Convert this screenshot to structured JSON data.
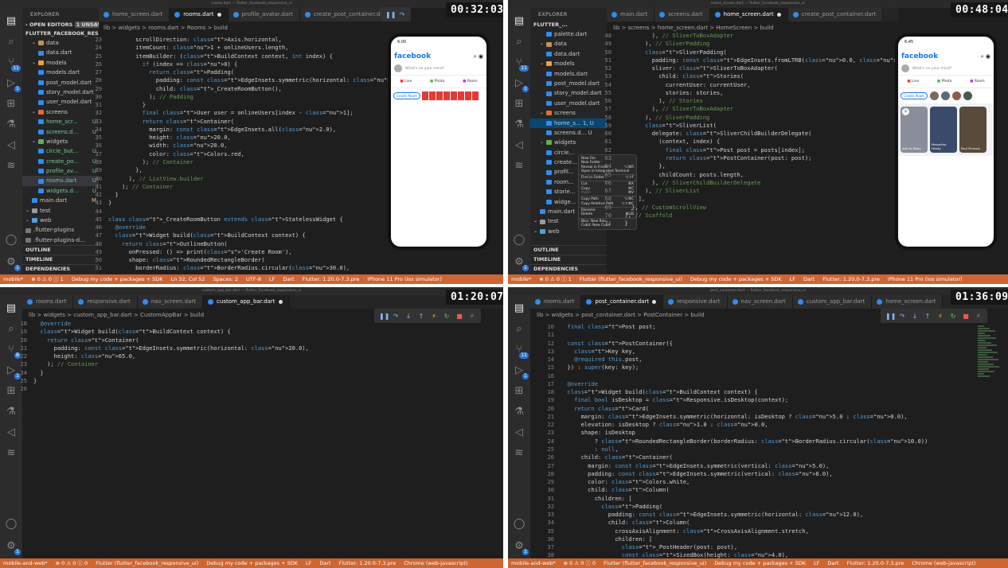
{
  "app": "Visual Studio Code",
  "panes": [
    {
      "timestamp": "00:32:03",
      "window_title": "rooms.dart — flutter_facebook_responsive_ui",
      "tabs": [
        "home_screen.dart",
        "rooms.dart",
        "profile_avatar.dart",
        "create_post_container.dart"
      ],
      "breadcrumb": "lib > widgets > rooms.dart > Rooms > build",
      "explorer": {
        "header": "EXPLORER",
        "open_editors": "OPEN EDITORS",
        "unsaved": "1 UNSAVED",
        "project": "FLUTTER_FACEBOOK_RESPO...",
        "items": [
          {
            "label": "data",
            "status": ""
          },
          {
            "label": "data.dart",
            "status": ""
          },
          {
            "label": "models",
            "status": ""
          },
          {
            "label": "models.dart",
            "status": ""
          },
          {
            "label": "post_model.dart",
            "status": ""
          },
          {
            "label": "story_model.dart",
            "status": ""
          },
          {
            "label": "user_model.dart",
            "status": ""
          },
          {
            "label": "screens",
            "status": ""
          },
          {
            "label": "home_scr...",
            "status": "U"
          },
          {
            "label": "screens.d...",
            "status": "U"
          },
          {
            "label": "widgets",
            "status": ""
          },
          {
            "label": "circle_but...",
            "status": "U"
          },
          {
            "label": "create_po...",
            "status": "U"
          },
          {
            "label": "profile_av...",
            "status": "U"
          },
          {
            "label": "rooms.dart",
            "status": "U"
          },
          {
            "label": "widgets.d...",
            "status": "U"
          },
          {
            "label": "main.dart",
            "status": "M"
          },
          {
            "label": "test",
            "status": ""
          },
          {
            "label": "web",
            "status": ""
          },
          {
            "label": ".flutter-plugins",
            "status": ""
          },
          {
            "label": ".flutter-plugins-d...",
            "status": ""
          }
        ],
        "sections": [
          "OUTLINE",
          "TIMELINE",
          "DEPENDENCIES"
        ]
      },
      "code": [
        {
          "n": "23",
          "t": "        scrollDirection: Axis.horizontal,"
        },
        {
          "n": "24",
          "t": "        itemCount: 1 + onlineUsers.length,"
        },
        {
          "n": "25",
          "t": "        itemBuilder: (BuildContext context, int index) {"
        },
        {
          "n": "26",
          "t": "          if (index == 0) {"
        },
        {
          "n": "27",
          "t": "            return Padding("
        },
        {
          "n": "28",
          "t": "              padding: const EdgeInsets.symmetric(horizontal: 8.0),"
        },
        {
          "n": "29",
          "t": "              child: _CreateRoomButton(),"
        },
        {
          "n": "30",
          "t": "            ); // Padding"
        },
        {
          "n": "31",
          "t": "          }"
        },
        {
          "n": "32",
          "t": "          final User user = onlineUsers[index - 1];"
        },
        {
          "n": "33",
          "t": "          return Container("
        },
        {
          "n": "34",
          "t": "            margin: const EdgeInsets.all(2.0),"
        },
        {
          "n": "35",
          "t": "            height: 20.0,"
        },
        {
          "n": "36",
          "t": "            width: 20.0,"
        },
        {
          "n": "37",
          "t": "            color: Colors.red,"
        },
        {
          "n": "38",
          "t": "          ); // Container"
        },
        {
          "n": "39",
          "t": "        },"
        },
        {
          "n": "40",
          "t": "      ), // ListView.builder"
        },
        {
          "n": "41",
          "t": "    ); // Container"
        },
        {
          "n": "42",
          "t": "  }"
        },
        {
          "n": "43",
          "t": "}"
        },
        {
          "n": "44",
          "t": ""
        },
        {
          "n": "45",
          "t": "class _CreateRoomButton extends StatelessWidget {"
        },
        {
          "n": "46",
          "t": "  @override"
        },
        {
          "n": "47",
          "t": "  Widget build(BuildContext context) {"
        },
        {
          "n": "48",
          "t": "    return OutlineButton("
        },
        {
          "n": "49",
          "t": "      onPressed: () => print('Create Room'),"
        },
        {
          "n": "50",
          "t": "      shape: RoundedRectangleBorder("
        },
        {
          "n": "51",
          "t": "        borderRadius: BorderRadius.circular(30.0),"
        }
      ],
      "status": [
        "mobile*",
        "⊗ 0 ⚠ 0 ⓘ 1",
        "Debug my code + packages + SDK",
        "Ln 32, Col 52",
        "Spaces: 2",
        "UTF-8",
        "LF",
        "Dart",
        "Flutter: 1.20.0-7.3.pre",
        "iPhone 11 Pro (ios simulator)"
      ],
      "phone": {
        "time": "6:00",
        "title": "facebook",
        "prompt": "What's on your mind?",
        "actions": [
          "Live",
          "Photo",
          "Room"
        ],
        "create_room": "Create Room"
      }
    },
    {
      "timestamp": "00:48:04",
      "window_title": "home_screen.dart — flutter_facebook_responsive_ui",
      "tabs": [
        "main.dart",
        "screens.dart",
        "home_screen.dart",
        "create_post_container.dart"
      ],
      "breadcrumb": "lib > screens > home_screen.dart > HomeScreen > build",
      "explorer": {
        "header": "EXPLORER",
        "project": "FLUTTER_...",
        "items": [
          {
            "label": "palette.dart",
            "status": ""
          },
          {
            "label": "data",
            "status": ""
          },
          {
            "label": "data.dart",
            "status": ""
          },
          {
            "label": "models",
            "status": ""
          },
          {
            "label": "models.dart",
            "status": ""
          },
          {
            "label": "post_model.dart",
            "status": ""
          },
          {
            "label": "story_model.dart",
            "status": ""
          },
          {
            "label": "user_model.dart",
            "status": ""
          },
          {
            "label": "screens",
            "status": ""
          },
          {
            "label": "home_s... 1, U",
            "status": ""
          },
          {
            "label": "screens.d... U",
            "status": ""
          },
          {
            "label": "widgets",
            "status": ""
          },
          {
            "label": "circle...",
            "status": ""
          },
          {
            "label": "create...",
            "status": ""
          },
          {
            "label": "profil...",
            "status": ""
          },
          {
            "label": "room...",
            "status": ""
          },
          {
            "label": "storie...",
            "status": ""
          },
          {
            "label": "widge...",
            "status": ""
          },
          {
            "label": "main.dart",
            "status": ""
          },
          {
            "label": "test",
            "status": ""
          },
          {
            "label": "web",
            "status": ""
          }
        ],
        "sections": [
          "OUTLINE",
          "TIMELINE",
          "DEPENDENCIES"
        ]
      },
      "context_menu": [
        {
          "l": "New File",
          "k": ""
        },
        {
          "l": "New Folder",
          "k": ""
        },
        {
          "l": "Reveal in Finder",
          "k": "⌥⌘R"
        },
        {
          "l": "Open in Integrated Terminal",
          "k": ""
        },
        {
          "l": "Find in Folder...",
          "k": "⌥⇧F"
        },
        {
          "l": "Cut",
          "k": "⌘X"
        },
        {
          "l": "Copy",
          "k": "⌘C"
        },
        {
          "l": "Paste",
          "k": "⌘V"
        },
        {
          "l": "Copy Path",
          "k": "⌥⌘C"
        },
        {
          "l": "Copy Relative Path",
          "k": "⌥⇧⌘C"
        },
        {
          "l": "Rename",
          "k": "↵"
        },
        {
          "l": "Delete",
          "k": "⌘⌫"
        },
        {
          "l": "Bloc: New Bloc",
          "k": ""
        },
        {
          "l": "Cubit: New Cubit",
          "k": ""
        }
      ],
      "code": [
        {
          "n": "48",
          "t": "          ), // SliverToBoxAdapter"
        },
        {
          "n": "49",
          "t": "        ), // SliverPadding"
        },
        {
          "n": "50",
          "t": "        SliverPadding("
        },
        {
          "n": "51",
          "t": "          padding: const EdgeInsets.fromLTRB(0.0, 5.0, 0.0, 5.0),"
        },
        {
          "n": "52",
          "t": "          sliver: SliverToBoxAdapter("
        },
        {
          "n": "53",
          "t": "            child: Stories("
        },
        {
          "n": "54",
          "t": "              currentUser: currentUser,"
        },
        {
          "n": "55",
          "t": "              stories: stories,"
        },
        {
          "n": "56",
          "t": "            ), // Stories"
        },
        {
          "n": "57",
          "t": "          ), // SliverToBoxAdapter"
        },
        {
          "n": "58",
          "t": "        ), // SliverPadding"
        },
        {
          "n": "59",
          "t": "        SliverList("
        },
        {
          "n": "60",
          "t": "          delegate: SliverChildBuilderDelegate("
        },
        {
          "n": "61",
          "t": "            (context, index) {"
        },
        {
          "n": "62",
          "t": "              final Post post = posts[index];"
        },
        {
          "n": "63",
          "t": "              return PostContainer(post: post);"
        },
        {
          "n": "64",
          "t": "            },"
        },
        {
          "n": "65",
          "t": "            childCount: posts.length,"
        },
        {
          "n": "66",
          "t": "          ), // SliverChildBuilderDelegate"
        },
        {
          "n": "67",
          "t": "        ), // SliverList"
        },
        {
          "n": "68",
          "t": "      ],"
        },
        {
          "n": "69",
          "t": "    ), // CustomScrollView"
        },
        {
          "n": "70",
          "t": "  ); // Scaffold"
        },
        {
          "n": "71",
          "t": "  }"
        }
      ],
      "status": [
        "mobile*",
        "⊗ 0 ⚠ 0 ⓘ 1",
        "Flutter (flutter_facebook_responsive_ui)",
        "Debug my code + packages + SDK",
        "LF",
        "Dart",
        "Flutter: 1.20.0-7.3.pre",
        "iPhone 11 Pro (ios simulator)"
      ],
      "phone": {
        "time": "6:45",
        "title": "facebook",
        "prompt": "What's on your mind?",
        "actions": [
          "Live",
          "Photo",
          "Room"
        ],
        "create_room": "Create Room",
        "stories": [
          "Add to Story",
          "Marcelina Hirsky",
          "Paul Pinnock"
        ]
      }
    },
    {
      "timestamp": "01:20:07",
      "window_title": "custom_app_bar.dart — flutter_facebook_responsive_ui",
      "tabs": [
        "rooms.dart",
        "responsive.dart",
        "nav_screen.dart",
        "custom_app_bar.dart"
      ],
      "breadcrumb": "lib > widgets > custom_app_bar.dart > CustomAppBar > build",
      "code": [
        {
          "n": "18",
          "t": "  @override"
        },
        {
          "n": "19",
          "t": "  Widget build(BuildContext context) {"
        },
        {
          "n": "20",
          "t": "    return Container("
        },
        {
          "n": "21",
          "t": "      padding: const EdgeInsets.symmetric(horizontal: 20.0),"
        },
        {
          "n": "22",
          "t": "      height: 65.0,"
        },
        {
          "n": "23",
          "t": "    ); // Container"
        },
        {
          "n": "24",
          "t": "  }"
        },
        {
          "n": "25",
          "t": "}"
        },
        {
          "n": "26",
          "t": ""
        }
      ],
      "status": [
        "mobile-and-web*",
        "⊗ 0 ⚠ 0 ⓘ 0",
        "Flutter (flutter_facebook_responsive_ui)",
        "Debug my code + packages + SDK",
        "LF",
        "Dart",
        "Flutter: 1.20.0-7.3.pre",
        "Chrome (web-javascript)"
      ]
    },
    {
      "timestamp": "01:36:09",
      "window_title": "post_container.dart — flutter_facebook_responsive_ui",
      "tabs": [
        "rooms.dart",
        "post_container.dart",
        "responsive.dart",
        "nav_screen.dart",
        "custom_app_bar.dart",
        "home_screen.dart"
      ],
      "breadcrumb": "lib > widgets > post_container.dart > PostContainer > build",
      "code": [
        {
          "n": "10",
          "t": "  final Post post;"
        },
        {
          "n": "11",
          "t": ""
        },
        {
          "n": "12",
          "t": "  const PostContainer({"
        },
        {
          "n": "13",
          "t": "    Key key,"
        },
        {
          "n": "14",
          "t": "    @required this.post,"
        },
        {
          "n": "15",
          "t": "  }) : super(key: key);"
        },
        {
          "n": "16",
          "t": ""
        },
        {
          "n": "17",
          "t": "  @override"
        },
        {
          "n": "18",
          "t": "  Widget build(BuildContext context) {"
        },
        {
          "n": "19",
          "t": "    final bool isDesktop = Responsive.isDesktop(context);"
        },
        {
          "n": "20",
          "t": "    return Card("
        },
        {
          "n": "21",
          "t": "      margin: EdgeInsets.symmetric(horizontal: isDesktop ? 5.0 : 0.0),"
        },
        {
          "n": "22",
          "t": "      elevation: isDesktop ? 1.0 : 0.0,"
        },
        {
          "n": "23",
          "t": "      shape: isDesktop"
        },
        {
          "n": "24",
          "t": "          ? RoundedRectangleBorder(borderRadius: BorderRadius.circular(10.0))"
        },
        {
          "n": "25",
          "t": "          : null,"
        },
        {
          "n": "26",
          "t": "      child: Container("
        },
        {
          "n": "27",
          "t": "        margin: const EdgeInsets.symmetric(vertical: 5.0),"
        },
        {
          "n": "28",
          "t": "        padding: const EdgeInsets.symmetric(vertical: 8.0),"
        },
        {
          "n": "29",
          "t": "        color: Colors.white,"
        },
        {
          "n": "30",
          "t": "        child: Column("
        },
        {
          "n": "31",
          "t": "          children: ["
        },
        {
          "n": "32",
          "t": "            Padding("
        },
        {
          "n": "33",
          "t": "              padding: const EdgeInsets.symmetric(horizontal: 12.0),"
        },
        {
          "n": "34",
          "t": "              child: Column("
        },
        {
          "n": "35",
          "t": "                crossAxisAlignment: CrossAxisAlignment.stretch,"
        },
        {
          "n": "36",
          "t": "                children: ["
        },
        {
          "n": "37",
          "t": "                  _PostHeader(post: post),"
        },
        {
          "n": "38",
          "t": "                  const SizedBox(height: 4.0),"
        },
        {
          "n": "39",
          "t": "                  Text(post.caption),"
        }
      ],
      "status": [
        "mobile-and-web*",
        "⊗ 0 ⚠ 0 ⓘ 0",
        "Flutter (flutter_facebook_responsive_ui)",
        "Debug my code + packages + SDK",
        "LF",
        "Dart",
        "Flutter: 1.20.0-7.3.pre",
        "Chrome (web-javascript)"
      ]
    }
  ],
  "colors": {
    "status_orange": "#cc6633",
    "editor_bg": "#1e1e1e",
    "sidebar_bg": "#252526",
    "facebook_blue": "#1877f2"
  }
}
